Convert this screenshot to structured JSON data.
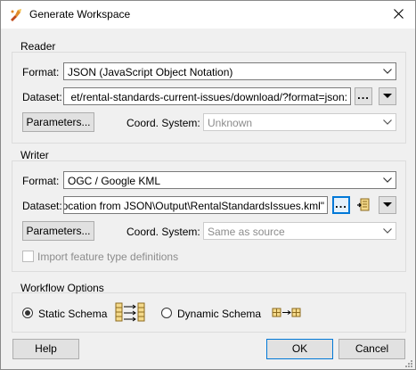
{
  "window": {
    "title": "Generate Workspace"
  },
  "reader": {
    "group_label": "Reader",
    "format_label": "Format:",
    "format_value": "JSON (JavaScript Object Notation)",
    "dataset_label": "Dataset:",
    "dataset_value": "et/rental-standards-current-issues/download/?format=json:",
    "browse_label": "...",
    "parameters_label": "Parameters...",
    "coord_label": "Coord. System:",
    "coord_value": "Unknown"
  },
  "writer": {
    "group_label": "Writer",
    "format_label": "Format:",
    "format_value": "OGC / Google KML",
    "dataset_label": "Dataset:",
    "dataset_value": "ocation from JSON\\Output\\RentalStandardsIssues.kml\"",
    "browse_label": "...",
    "parameters_label": "Parameters...",
    "coord_label": "Coord. System:",
    "coord_value": "Same as source",
    "import_label": "Import feature type definitions",
    "import_checked": false
  },
  "workflow": {
    "group_label": "Workflow Options",
    "static_label": "Static Schema",
    "dynamic_label": "Dynamic Schema",
    "selected": "static"
  },
  "footer": {
    "help_label": "Help",
    "ok_label": "OK",
    "cancel_label": "Cancel"
  },
  "colors": {
    "accent": "#0078d7",
    "schema_icon": "#8b6a1f"
  },
  "icons": [
    "app-icon",
    "close-icon",
    "chevron-down-icon",
    "triangle-down-icon",
    "browse-icon",
    "static-schema-icon",
    "dynamic-schema-icon"
  ]
}
